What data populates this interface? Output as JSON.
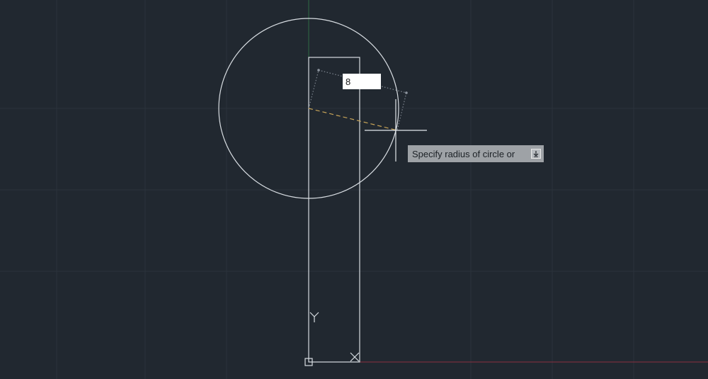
{
  "dynamic_input": {
    "value": "8"
  },
  "tooltip": {
    "text": "Specify radius of circle or",
    "options_icon": "down-arrow-icon"
  },
  "ucs_icon": {
    "y_label": "Y"
  },
  "colors": {
    "background": "#212830",
    "geometry": "#d8dde2",
    "x_axis": "#8a3040",
    "y_axis": "#2e6a44",
    "rubber_band": "#c9a558",
    "tooltip_bg": "#9ea2a6",
    "input_bg": "#ffffff"
  }
}
